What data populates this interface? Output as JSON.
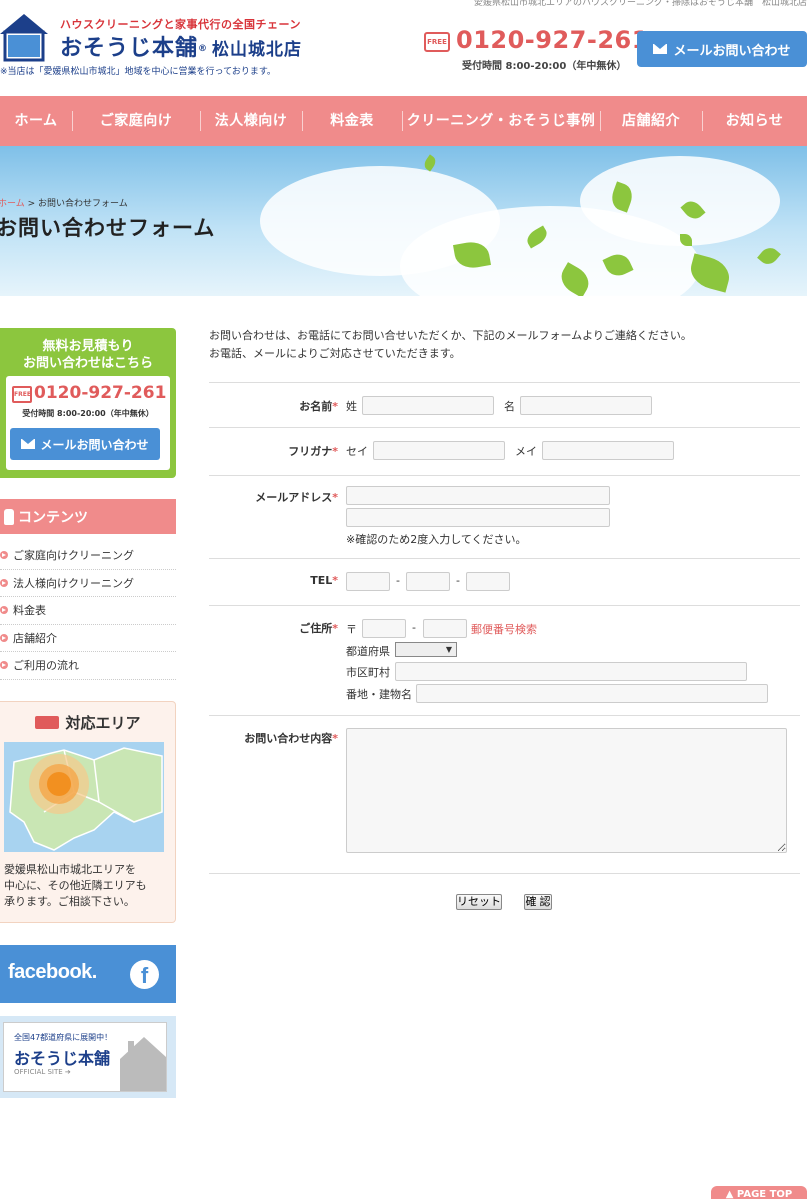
{
  "header": {
    "topline": "愛媛県松山市城北エリアのハウスクリーニング・掃除はおそうじ本舗　松山城北店",
    "logo_badge": "おそうじ本舗",
    "tagline": "ハウスクリーニングと家事代行の全国チェーン",
    "brand": "おそうじ本舗",
    "brand_reg": "®",
    "branch": "松山城北店",
    "note": "※当店は「愛媛県松山市城北」地域を中心に営業を行っております。",
    "free_label": "FREE",
    "phone": "0120-927-261",
    "hours": "受付時間 8:00-20:00（年中無休）",
    "mail_button": "メールお問い合わせ"
  },
  "nav": {
    "items": [
      {
        "label": "ホーム"
      },
      {
        "label": "ご家庭向け"
      },
      {
        "label": "法人様向け"
      },
      {
        "label": "料金表"
      },
      {
        "label": "クリーニング・おそうじ事例"
      },
      {
        "label": "店舗紹介"
      },
      {
        "label": "お知らせ"
      }
    ]
  },
  "hero": {
    "breadcrumb_home": "ホーム",
    "breadcrumb_sep": ">",
    "breadcrumb_current": "お問い合わせフォーム",
    "title": "お問い合わせフォーム"
  },
  "sidebar": {
    "contact_title": "無料お見積もり\nお問い合わせはこちら",
    "free_label": "FREE",
    "phone": "0120-927-261",
    "hours": "受付時間 8:00-20:00（年中無休）",
    "mail_button": "メールお問い合わせ",
    "contents_title": "コンテンツ",
    "links": [
      {
        "label": "ご家庭向けクリーニング"
      },
      {
        "label": "法人様向けクリーニング"
      },
      {
        "label": "料金表"
      },
      {
        "label": "店舗紹介"
      },
      {
        "label": "ご利用の流れ"
      }
    ],
    "area_title": "対応エリア",
    "area_text": "愛媛県松山市城北エリアを\n中心に、その他近隣エリアも\n承ります。ご相談下さい。",
    "facebook": "facebook.",
    "facebook_icon": "f",
    "official_tag": "全国47都道府県に展開中！",
    "official_name": "おそうじ本舗",
    "official_site": "OFFICIAL SITE ➔"
  },
  "form": {
    "intro": "お問い合わせは、お電話にてお問い合せいただくか、下記のメールフォームよりご連絡ください。\nお電話、メールによりご対応させていただきます。",
    "required_mark": "*",
    "name_label": "お名前",
    "last_name_label": "姓",
    "first_name_label": "名",
    "kana_label": "フリガナ",
    "kana_last_label": "セイ",
    "kana_first_label": "メイ",
    "email_label": "メールアドレス",
    "email_note": "※確認のため2度入力してください。",
    "tel_label": "TEL",
    "tel_sep": "-",
    "address_label": "ご住所",
    "postal_mark": "〒",
    "postal_sep": "-",
    "postal_search": "郵便番号検索",
    "prefecture_label": "都道府県",
    "prefecture_arrow": "▼",
    "city_label": "市区町村",
    "street_label": "番地・建物名",
    "message_label": "お問い合わせ内容",
    "reset_button": "リセット",
    "confirm_button": "確 認"
  },
  "pagetop": "▲ PAGE TOP",
  "colors": {
    "accent_pink": "#f08b8b",
    "accent_green": "#8cc63e",
    "accent_blue": "#4a90d6",
    "brand_navy": "#1c3f8a",
    "phone_red": "#e05b5b"
  }
}
